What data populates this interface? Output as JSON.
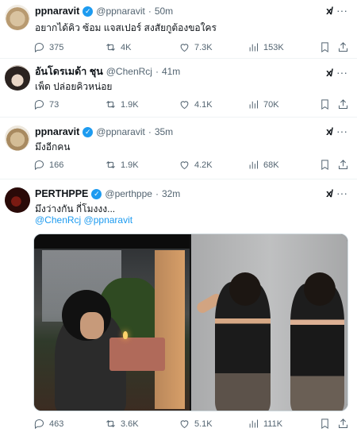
{
  "tweets": [
    {
      "name": "ppnaravit",
      "handle": "@ppnaravit",
      "time": "50m",
      "text": "อยากได้คิว ซ้อม แจสเปอร์ สงสัยกูต้องขอใคร",
      "reply": "375",
      "retweet": "4K",
      "like": "7.3K",
      "views": "153K"
    },
    {
      "name": "อันโดรเมด้า ชุน",
      "handle": "@ChenRcj",
      "time": "41m",
      "text": "เพ็ด ปล่อยคิวหน่อย",
      "reply": "73",
      "retweet": "1.9K",
      "like": "4.1K",
      "views": "70K"
    },
    {
      "name": "ppnaravit",
      "handle": "@ppnaravit",
      "time": "35m",
      "text": "มึงอีกคน",
      "reply": "166",
      "retweet": "1.9K",
      "like": "4.2K",
      "views": "68K"
    },
    {
      "name": "PERTHPPE",
      "handle": "@perthppe",
      "time": "32m",
      "text": "มึงว่างกัน กี่โมงงง...",
      "mentions": "@ChenRcj @ppnaravit",
      "reply": "463",
      "retweet": "3.6K",
      "like": "5.1K",
      "views": "111K"
    }
  ],
  "ui": {
    "separator": "·",
    "more_glyph": "···",
    "grok_glyph": "x/",
    "verified_glyph": "✓"
  },
  "colors": {
    "accent": "#1d9bf0",
    "text": "#0f1419",
    "muted": "#536471",
    "divider": "#eff3f4"
  }
}
